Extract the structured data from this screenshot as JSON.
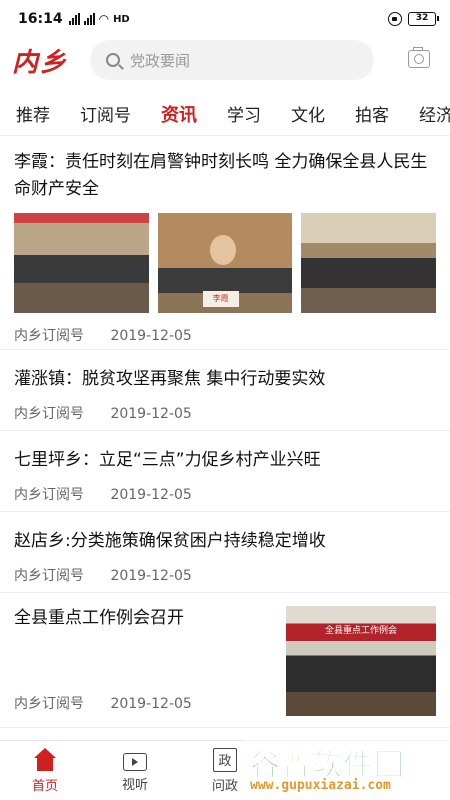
{
  "status_bar": {
    "time": "16:14",
    "network": "HD",
    "battery": "32"
  },
  "header": {
    "logo": "内乡",
    "search_placeholder": "党政要闻"
  },
  "tabs": [
    {
      "label": "推荐"
    },
    {
      "label": "订阅号"
    },
    {
      "label": "资讯",
      "active": true
    },
    {
      "label": "学习"
    },
    {
      "label": "文化"
    },
    {
      "label": "拍客"
    },
    {
      "label": "经济"
    }
  ],
  "feed": [
    {
      "title": "李霞：责任时刻在肩警钟时刻长鸣 全力确保全县人民生命财产安全",
      "source": "内乡订阅号",
      "date": "2019-12-05",
      "image_caption": "李霞"
    },
    {
      "title": "灌涨镇：脱贫攻坚再聚焦 集中行动要实效",
      "source": "内乡订阅号",
      "date": "2019-12-05"
    },
    {
      "title": "七里坪乡：立足“三点”力促乡村产业兴旺",
      "source": "内乡订阅号",
      "date": "2019-12-05"
    },
    {
      "title": "赵店乡:分类施策确保贫困户持续稳定增收",
      "source": "内乡订阅号",
      "date": "2019-12-05"
    },
    {
      "title": "全县重点工作例会召开",
      "source": "内乡订阅号",
      "date": "2019-12-05",
      "image_caption": "全县重点工作例会"
    }
  ],
  "bottom_nav": [
    {
      "label": "首页",
      "icon": "home-icon",
      "active": true
    },
    {
      "label": "视听",
      "icon": "tv-icon"
    },
    {
      "label": "问政",
      "icon": "政"
    }
  ],
  "watermark": {
    "name": "谷普软件园",
    "url": "www.gupuxiazai.com"
  },
  "colors": {
    "accent": "#d02020",
    "watermark_green": "#1f9a49",
    "watermark_orange": "#e39a2e"
  }
}
